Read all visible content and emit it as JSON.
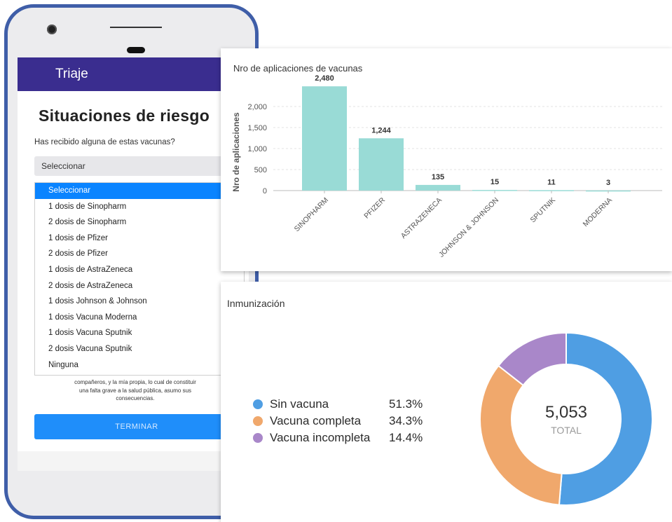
{
  "phone": {
    "app_title": "Triaje",
    "page_title": "Situaciones de riesgo",
    "question": "Has recibido alguna de estas vacunas?",
    "select_value": "Seleccionar",
    "options": [
      "Seleccionar",
      "1 dosis de Sinopharm",
      "2 dosis de Sinopharm",
      "1 dosis de Pfizer",
      "2 dosis de Pfizer",
      "1 dosis de AstraZeneca",
      "2 dosis de AstraZeneca",
      "1 dosis Johnson & Johnson",
      "1 dosis Vacuna Moderna",
      "1 dosis Vacuna Sputnik",
      "2 dosis Vacuna Sputnik",
      "Ninguna"
    ],
    "disclaimer_lines": [
      "compañeros, y la mía propia, lo cual de constituir",
      "una falta grave a la salud pública, asumo sus",
      "consecuencias."
    ],
    "finish_label": "TERMINAR"
  },
  "bar_card": {
    "title": "Nro de aplicaciones de vacunas"
  },
  "donut_card": {
    "title": "Inmunización",
    "total_value": "5,053",
    "total_label": "TOTAL",
    "legend": [
      {
        "label": "Sin vacuna",
        "pct": "51.3%",
        "color": "#4f9ee3"
      },
      {
        "label": "Vacuna completa",
        "pct": "34.3%",
        "color": "#f0a86c"
      },
      {
        "label": "Vacuna incompleta",
        "pct": "14.4%",
        "color": "#a987c9"
      }
    ]
  },
  "chart_data": [
    {
      "type": "bar",
      "title": "Nro de aplicaciones de vacunas",
      "xlabel": "",
      "ylabel": "Nro de aplicaciones",
      "categories": [
        "SINOPHARM",
        "PFIZER",
        "ASTRAZENECA",
        "JOHNSON & JOHNSON",
        "SPUTNIK",
        "MODERNA"
      ],
      "values": [
        2480,
        1244,
        135,
        15,
        11,
        3
      ],
      "value_labels": [
        "2,480",
        "1,244",
        "135",
        "15",
        "11",
        "3"
      ],
      "yticks": [
        "0",
        "500",
        "1,000",
        "1,500",
        "2,000"
      ],
      "ylim": [
        0,
        2500
      ],
      "grid": true,
      "color": "#99dbd6"
    },
    {
      "type": "pie",
      "title": "Inmunización",
      "categories": [
        "Sin vacuna",
        "Vacuna completa",
        "Vacuna incompleta"
      ],
      "values": [
        51.3,
        34.3,
        14.4
      ],
      "total": "5,053",
      "colors": [
        "#4f9ee3",
        "#f0a86c",
        "#a987c9"
      ]
    }
  ]
}
